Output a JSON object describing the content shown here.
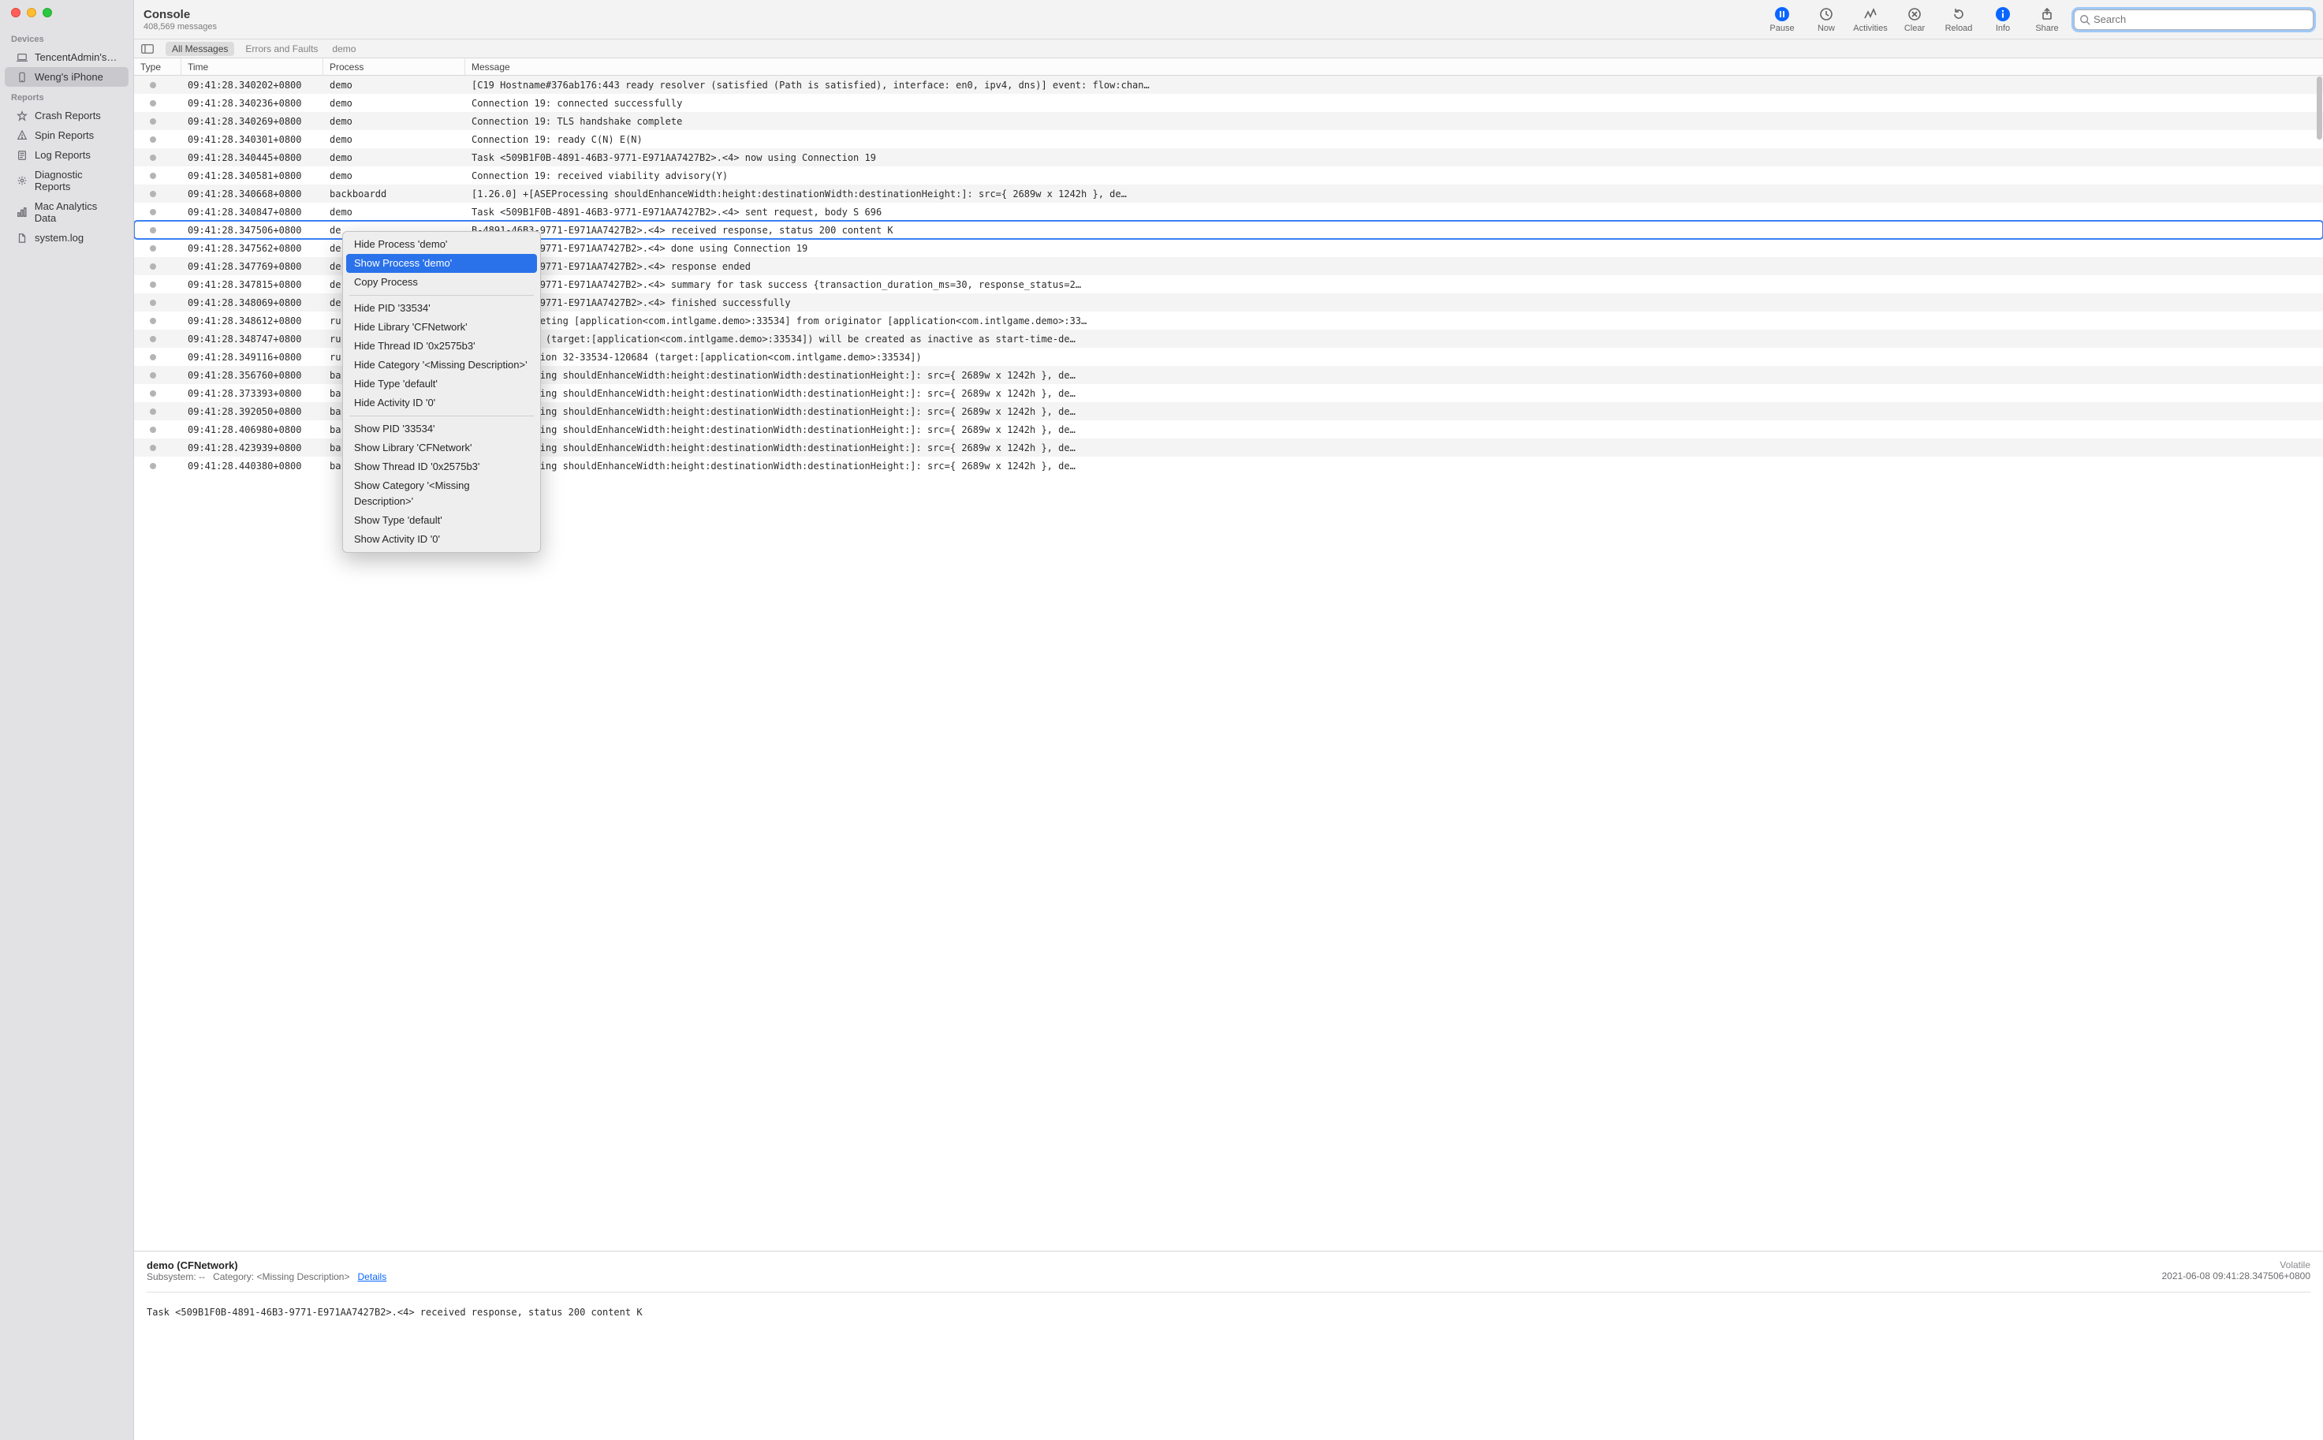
{
  "header": {
    "title": "Console",
    "subtitle": "408,569 messages"
  },
  "toolbar": {
    "pause": "Pause",
    "now": "Now",
    "activities": "Activities",
    "clear": "Clear",
    "reload": "Reload",
    "info": "Info",
    "share": "Share",
    "search_placeholder": "Search"
  },
  "filterbar": {
    "all_messages": "All Messages",
    "errors_faults": "Errors and Faults",
    "demo": "demo"
  },
  "sidebar": {
    "devices_title": "Devices",
    "reports_title": "Reports",
    "devices": [
      {
        "label": "TencentAdmin's…",
        "icon": "laptop"
      },
      {
        "label": "Weng's iPhone",
        "icon": "phone",
        "selected": true
      }
    ],
    "reports": [
      {
        "label": "Crash Reports",
        "icon": "crash"
      },
      {
        "label": "Spin Reports",
        "icon": "spin"
      },
      {
        "label": "Log Reports",
        "icon": "log"
      },
      {
        "label": "Diagnostic Reports",
        "icon": "diag"
      },
      {
        "label": "Mac Analytics Data",
        "icon": "analytics"
      },
      {
        "label": "system.log",
        "icon": "file"
      }
    ]
  },
  "columns": {
    "type": "Type",
    "time": "Time",
    "process": "Process",
    "message": "Message"
  },
  "rows": [
    {
      "time": "09:41:28.340202+0800",
      "proc": "demo",
      "msg": "[C19 Hostname#376ab176:443 ready resolver (satisfied (Path is satisfied), interface: en0, ipv4, dns)] event: flow:chan…"
    },
    {
      "time": "09:41:28.340236+0800",
      "proc": "demo",
      "msg": "Connection 19: connected successfully"
    },
    {
      "time": "09:41:28.340269+0800",
      "proc": "demo",
      "msg": "Connection 19: TLS handshake complete"
    },
    {
      "time": "09:41:28.340301+0800",
      "proc": "demo",
      "msg": "Connection 19: ready C(N) E(N)"
    },
    {
      "time": "09:41:28.340445+0800",
      "proc": "demo",
      "msg": "Task <509B1F0B-4891-46B3-9771-E971AA7427B2>.<4> now using Connection 19"
    },
    {
      "time": "09:41:28.340581+0800",
      "proc": "demo",
      "msg": "Connection 19: received viability advisory(Y)"
    },
    {
      "time": "09:41:28.340668+0800",
      "proc": "backboardd",
      "msg": " [1.26.0]    +[ASEProcessing shouldEnhanceWidth:height:destinationWidth:destinationHeight:]: src={ 2689w x 1242h }, de…"
    },
    {
      "time": "09:41:28.340847+0800",
      "proc": "demo",
      "msg": "Task <509B1F0B-4891-46B3-9771-E971AA7427B2>.<4> sent request, body S 696"
    },
    {
      "time": "09:41:28.347506+0800",
      "proc": "de",
      "msg": "B-4891-46B3-9771-E971AA7427B2>.<4> received response, status 200 content K",
      "selected": true
    },
    {
      "time": "09:41:28.347562+0800",
      "proc": "de",
      "msg": "B-4891-46B3-9771-E971AA7427B2>.<4> done using Connection 19"
    },
    {
      "time": "09:41:28.347769+0800",
      "proc": "de",
      "msg": "B-4891-46B3-9771-E971AA7427B2>.<4> response ended"
    },
    {
      "time": "09:41:28.347815+0800",
      "proc": "de",
      "msg": "B-4891-46B3-9771-E971AA7427B2>.<4> summary for task success {transaction_duration_ms=30, response_status=2…"
    },
    {
      "time": "09:41:28.348069+0800",
      "proc": "de",
      "msg": "B-4891-46B3-9771-E971AA7427B2>.<4> finished successfully"
    },
    {
      "time": "09:41:28.348612+0800",
      "proc": "ru",
      "msg": "sertion targeting [application<com.intlgame.demo>:33534] from originator [application<com.intlgame.demo>:33…"
    },
    {
      "time": "09:41:28.348747+0800",
      "proc": "ru",
      "msg": "33534-120684 (target:[application<com.intlgame.demo>:33534]) will be created as inactive as start-time-de…"
    },
    {
      "time": "09:41:28.349116+0800",
      "proc": "ru",
      "msg": "iring assertion 32-33534-120684 (target:[application<com.intlgame.demo>:33534])"
    },
    {
      "time": "09:41:28.356760+0800",
      "proc": "ba",
      "msg": "+[ASEProcessing shouldEnhanceWidth:height:destinationWidth:destinationHeight:]: src={ 2689w x 1242h }, de…"
    },
    {
      "time": "09:41:28.373393+0800",
      "proc": "ba",
      "msg": "+[ASEProcessing shouldEnhanceWidth:height:destinationWidth:destinationHeight:]: src={ 2689w x 1242h }, de…"
    },
    {
      "time": "09:41:28.392050+0800",
      "proc": "ba",
      "msg": "+[ASEProcessing shouldEnhanceWidth:height:destinationWidth:destinationHeight:]: src={ 2689w x 1242h }, de…"
    },
    {
      "time": "09:41:28.406980+0800",
      "proc": "ba",
      "msg": "+[ASEProcessing shouldEnhanceWidth:height:destinationWidth:destinationHeight:]: src={ 2689w x 1242h }, de…"
    },
    {
      "time": "09:41:28.423939+0800",
      "proc": "ba",
      "msg": "+[ASEProcessing shouldEnhanceWidth:height:destinationWidth:destinationHeight:]: src={ 2689w x 1242h }, de…"
    },
    {
      "time": "09:41:28.440380+0800",
      "proc": "ba",
      "msg": "+[ASEProcessing shouldEnhanceWidth:height:destinationWidth:destinationHeight:]: src={ 2689w x 1242h }, de…"
    }
  ],
  "context_menu": [
    {
      "label": "Hide Process 'demo'"
    },
    {
      "label": "Show Process 'demo'",
      "selected": true
    },
    {
      "label": "Copy Process"
    },
    {
      "sep": true
    },
    {
      "label": "Hide PID '33534'"
    },
    {
      "label": "Hide Library 'CFNetwork'"
    },
    {
      "label": "Hide Thread ID '0x2575b3'"
    },
    {
      "label": "Hide Category '<Missing Description>'"
    },
    {
      "label": "Hide Type 'default'"
    },
    {
      "label": "Hide Activity ID '0'"
    },
    {
      "sep": true
    },
    {
      "label": "Show PID '33534'"
    },
    {
      "label": "Show Library 'CFNetwork'"
    },
    {
      "label": "Show Thread ID '0x2575b3'"
    },
    {
      "label": "Show Category '<Missing Description>'"
    },
    {
      "label": "Show Type 'default'"
    },
    {
      "label": "Show Activity ID '0'"
    }
  ],
  "detail": {
    "title": "demo (CFNetwork)",
    "volatile": "Volatile",
    "subsystem_label": "Subsystem:",
    "subsystem_value": "--",
    "category_label": "Category:",
    "category_value": "<Missing Description>",
    "details_link": "Details",
    "timestamp": "2021-06-08 09:41:28.347506+0800",
    "body": "Task <509B1F0B-4891-46B3-9771-E971AA7427B2>.<4> received response, status 200 content K"
  }
}
